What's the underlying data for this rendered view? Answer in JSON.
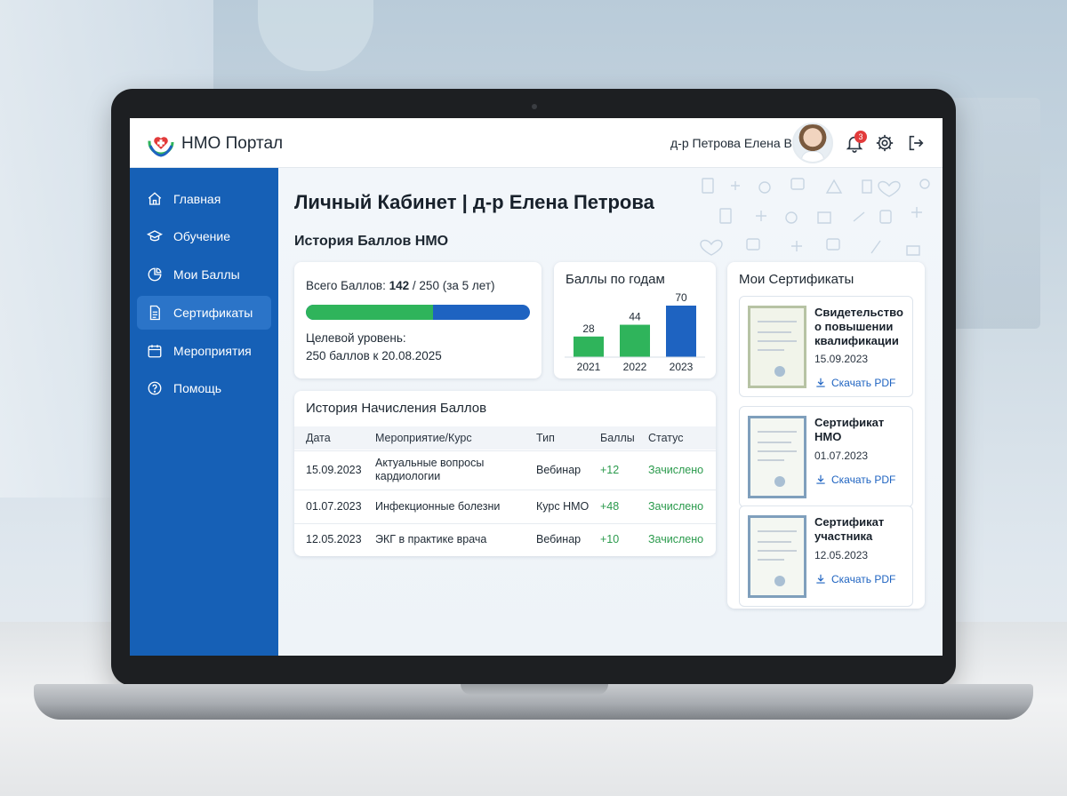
{
  "app": {
    "brand": "НМО Портал"
  },
  "header": {
    "user_name": "д-р Петрова Елена В.",
    "notifications_count": "3"
  },
  "sidebar": {
    "items": [
      {
        "label": "Главная",
        "icon": "home-icon",
        "active": false
      },
      {
        "label": "Обучение",
        "icon": "graduation-cap-icon",
        "active": false
      },
      {
        "label": "Мои Баллы",
        "icon": "pie-chart-icon",
        "active": false
      },
      {
        "label": "Сертификаты",
        "icon": "document-icon",
        "active": true
      },
      {
        "label": "Мероприятия",
        "icon": "calendar-icon",
        "active": false
      },
      {
        "label": "Помощь",
        "icon": "help-icon",
        "active": false
      }
    ]
  },
  "main": {
    "page_title": "Личный Кабинет | д-р Елена Петрова",
    "section_title": "История Баллов НМО",
    "total": {
      "label": "Всего Баллов:",
      "value": "142",
      "rest": "/ 250 (за 5 лет)",
      "progress_fraction": 0.568,
      "target_label": "Целевой уровень:",
      "target_value": "250 баллов к 20.08.2025"
    },
    "years": {
      "title": "Баллы по годам"
    },
    "history": {
      "title": "История Начисления Баллов",
      "columns": [
        "Дата",
        "Мероприятие/Курс",
        "Тип",
        "Баллы",
        "Статус"
      ],
      "rows": [
        {
          "date": "15.09.2023",
          "event": "Актуальные вопросы кардиологии",
          "type": "Вебинар",
          "points": "+12",
          "status": "Зачислено"
        },
        {
          "date": "01.07.2023",
          "event": "Инфекционные болезни",
          "type": "Курс НМО",
          "points": "+48",
          "status": "Зачислено"
        },
        {
          "date": "12.05.2023",
          "event": "ЭКГ в практике врача",
          "type": "Вебинар",
          "points": "+10",
          "status": "Зачислено"
        }
      ]
    },
    "certificates": {
      "title": "Мои Сертификаты",
      "download_label": "Скачать PDF",
      "items": [
        {
          "name": "Свидетельство о повышении квалификации",
          "date": "15.09.2023"
        },
        {
          "name": "Сертификат НМО",
          "date": "01.07.2023"
        },
        {
          "name": "Сертификат участника",
          "date": "12.05.2023"
        }
      ]
    }
  },
  "chart_data": {
    "type": "bar",
    "title": "Баллы по годам",
    "categories": [
      "2021",
      "2022",
      "2023"
    ],
    "values": [
      28,
      44,
      70
    ],
    "colors": [
      "#2fb45b",
      "#2fb45b",
      "#1e63c1"
    ],
    "ylim": [
      0,
      70
    ]
  },
  "colors": {
    "sidebar": "#1660b6",
    "accent": "#1e63c1",
    "success": "#2fb45b",
    "badge": "#e23b3b"
  }
}
